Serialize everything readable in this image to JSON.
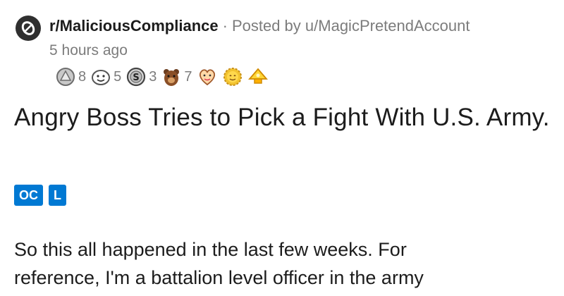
{
  "post": {
    "subreddit": "r/MaliciousCompliance",
    "separator": "·",
    "posted_by": "Posted by u/MagicPretendAccount",
    "time_ago": "5 hours ago",
    "awards": [
      {
        "icon": "silver-award-icon",
        "count": "8"
      },
      {
        "icon": "wholesome-award-icon",
        "count": "5"
      },
      {
        "icon": "coin-award-icon",
        "count": "3"
      },
      {
        "icon": "bear-award-icon",
        "count": "7"
      },
      {
        "icon": "heart-award-icon",
        "count": ""
      },
      {
        "icon": "sun-award-icon",
        "count": ""
      },
      {
        "icon": "gold-award-icon",
        "count": ""
      }
    ],
    "title": "Angry Boss Tries to Pick a Fight With U.S. Army.",
    "flairs": [
      "OC",
      "L"
    ],
    "body_line1": "So this all happened in the last few weeks. For",
    "body_line2": "reference, I'm a battalion level officer in the army"
  },
  "colors": {
    "flair_bg": "#0079d3",
    "meta_text": "#7c7c7c",
    "text": "#1c1c1c"
  }
}
